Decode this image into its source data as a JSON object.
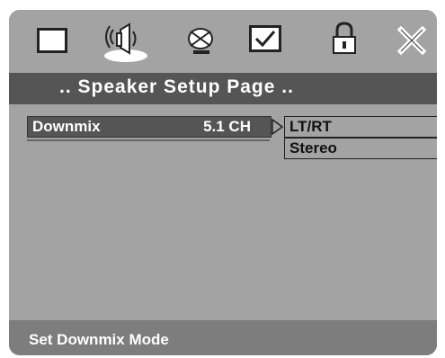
{
  "tabs": [
    {
      "icon": "tv-screen-icon",
      "label": ""
    },
    {
      "icon": "speaker-icon",
      "label": ""
    },
    {
      "icon": "disc-icon",
      "label": ""
    },
    {
      "icon": "checklist-icon",
      "label": ""
    },
    {
      "icon": "lock-icon",
      "label": ""
    },
    {
      "icon": "close-icon",
      "label": ""
    }
  ],
  "active_tab": 1,
  "page_title": ".. Speaker Setup Page ..",
  "menu": {
    "item_label": "Downmix",
    "item_value": "5.1 CH"
  },
  "submenu": {
    "options": [
      "LT/RT",
      "Stereo"
    ]
  },
  "status": "Set Downmix Mode",
  "colors": {
    "background": "#a3a3a3",
    "title_bar": "#555555",
    "status_bar": "#7d7d7d",
    "text_light": "#ffffff",
    "text_dark": "#111111"
  }
}
